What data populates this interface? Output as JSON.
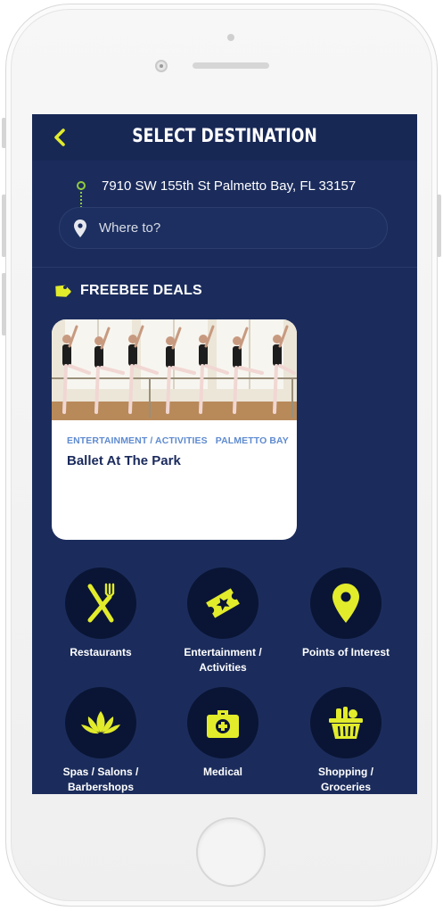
{
  "header": {
    "title": "SELECT DESTINATION",
    "back_icon": "chevron-left-icon"
  },
  "route": {
    "origin_address": "7910 SW 155th St  Palmetto Bay, FL 33157",
    "destination_placeholder": "Where to?"
  },
  "deals": {
    "section_title": "FREEBEE DEALS",
    "items": [
      {
        "category": "ENTERTAINMENT / ACTIVITIES",
        "location": "PALMETTO BAY",
        "title": "Ballet At The Park"
      }
    ]
  },
  "categories": [
    {
      "label_lines": [
        "Restaurants"
      ],
      "icon": "fork-knife-icon"
    },
    {
      "label_lines": [
        "Entertainment /",
        "Activities"
      ],
      "icon": "ticket-icon"
    },
    {
      "label_lines": [
        "Points of Interest"
      ],
      "icon": "map-pin-icon"
    },
    {
      "label_lines": [
        "Spas / Salons /",
        "Barbershops"
      ],
      "icon": "lotus-icon"
    },
    {
      "label_lines": [
        "Medical"
      ],
      "icon": "medical-kit-icon"
    },
    {
      "label_lines": [
        "Shopping /",
        "Groceries"
      ],
      "icon": "grocery-basket-icon"
    }
  ],
  "colors": {
    "background": "#1b2c5c",
    "accent": "#e2ec2b",
    "route_green": "#8fcb3f",
    "deal_meta": "#5f8bd0",
    "deal_title": "#1a2a5c",
    "icon_circle": "#0a1535"
  }
}
